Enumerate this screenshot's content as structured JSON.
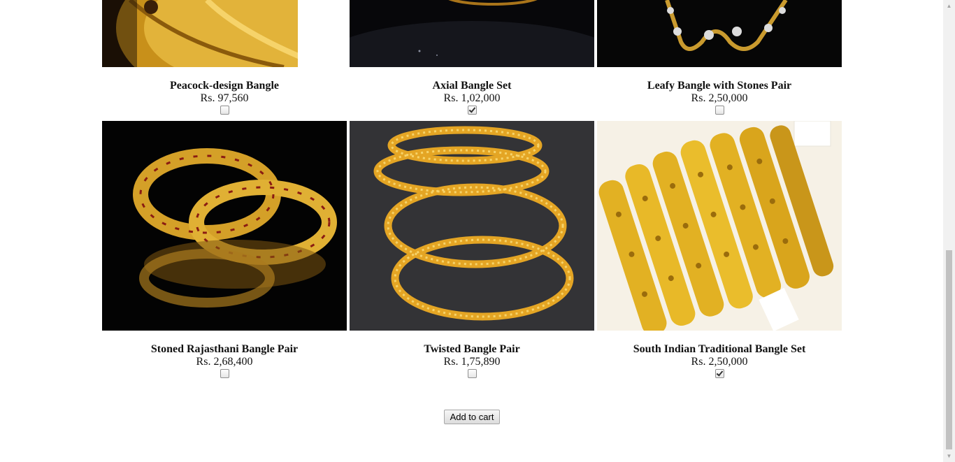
{
  "products": [
    {
      "name": "Peacock-design Bangle",
      "price": "Rs. 97,560",
      "checked": false,
      "icon": "gold-bangle-image"
    },
    {
      "name": "Axial Bangle Set",
      "price": "Rs. 1,02,000",
      "checked": true,
      "icon": "gold-bangle-image"
    },
    {
      "name": "Leafy Bangle with Stones Pair",
      "price": "Rs. 2,50,000",
      "checked": false,
      "icon": "gold-bangle-image"
    },
    {
      "name": "Stoned Rajasthani Bangle Pair",
      "price": "Rs. 2,68,400",
      "checked": false,
      "icon": "gold-bangle-image"
    },
    {
      "name": "Twisted Bangle Pair",
      "price": "Rs. 1,75,890",
      "checked": false,
      "icon": "gold-bangle-image"
    },
    {
      "name": "South Indian Traditional Bangle Set",
      "price": "Rs. 2,50,000",
      "checked": true,
      "icon": "gold-bangle-image"
    }
  ],
  "cart": {
    "add_label": "Add to cart"
  },
  "colors": {
    "gold": "#d9a21b",
    "dark_bg": "#050505",
    "light_bg": "#f4efe4"
  }
}
